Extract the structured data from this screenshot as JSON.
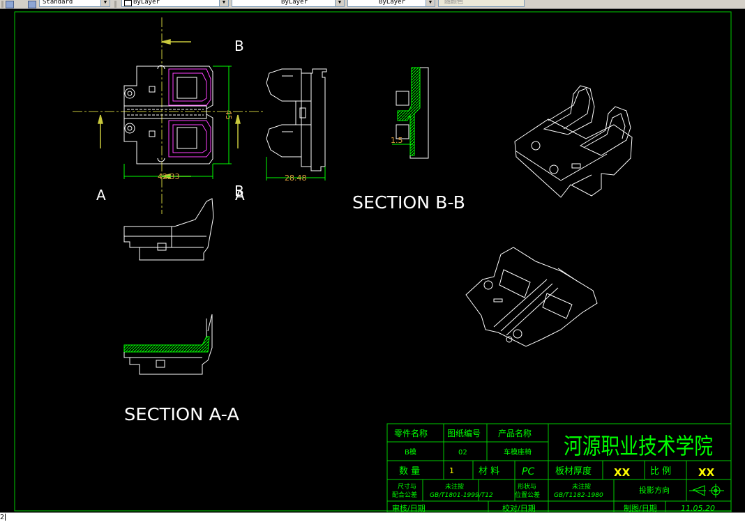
{
  "toolbar": {
    "text_style": "Standard",
    "layer_color": "ByLayer",
    "layer_linetype": "ByLayer",
    "layer_lineweight": "ByLayer",
    "plot_style": "随颜色"
  },
  "drawing": {
    "section_bb": "SECTION B-B",
    "section_aa": "SECTION A-A",
    "label_b_top": "B",
    "label_b_bottom": "B",
    "label_a_left": "A",
    "label_a_right": "A",
    "dim_width": "42.33",
    "dim_height": "45",
    "dim_side": "28.48",
    "dim_thick": "1.5"
  },
  "title_block": {
    "h_part_name": "零件名称",
    "h_drawing_no": "图纸编号",
    "h_product_name": "产品名称",
    "school": "河源职业技术学院",
    "part_name": "B模",
    "drawing_no": "02",
    "product_name": "车模座椅",
    "qty_label": "数 量",
    "qty_value": "1",
    "material_label": "材 料",
    "material_value": "PC",
    "thickness_label": "板材厚度",
    "thickness_value": "XX",
    "scale_label": "比 例",
    "scale_value": "XX",
    "dim_tol_label_1": "尺寸与",
    "dim_tol_label_2": "配合公差",
    "std_1_label": "未注按",
    "std_1_value": "GB/T1801-1999/T12",
    "geo_tol_label_1": "形状与",
    "geo_tol_label_2": "位置公差",
    "std_2_label": "未注按",
    "std_2_value": "GB/T1182-1980",
    "projection_label": "投影方向",
    "audit_label": "审核/日期",
    "design_label": "校对/日期",
    "draw_label": "制图/日期",
    "date_value": "11.05.20"
  },
  "cmdline": {
    "text": "2"
  },
  "colors": {
    "canvas": "#000000",
    "line": "#ffffff",
    "frame": "#00cc00",
    "dim": "#00ff00",
    "center": "#c8c83c",
    "dim_text": "#e0a040",
    "magenta": "#ff40ff",
    "title_text": "#00ff00",
    "value_text": "#ffff00"
  }
}
